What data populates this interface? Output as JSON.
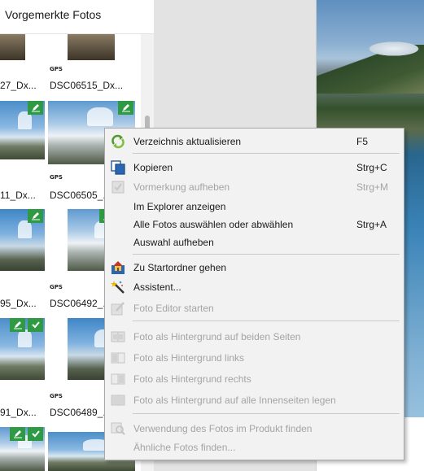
{
  "panel": {
    "title": "Vorgemerkte Fotos",
    "gps_label": "GPS",
    "filenames": {
      "row1_left": "27_Dx...",
      "row1_right": "DSC06515_Dx...",
      "row2_left": "11_Dx...",
      "row2_right": "DSC06505_...",
      "row3_left": "95_Dx...",
      "row3_right": "DSC06492_...",
      "row4_left": "91_Dx...",
      "row4_right": "DSC06489_..."
    }
  },
  "menu": {
    "items": [
      {
        "label": "Verzeichnis aktualisieren",
        "shortcut": "F5",
        "enabled": true,
        "icon": "refresh-icon"
      },
      {
        "label": "Kopieren",
        "shortcut": "Strg+C",
        "enabled": true,
        "icon": "copy-icon"
      },
      {
        "label": "Vormerkung aufheben",
        "shortcut": "Strg+M",
        "enabled": false,
        "icon": "unmark-icon"
      },
      {
        "label": "Im Explorer anzeigen",
        "shortcut": "",
        "enabled": true,
        "icon": ""
      },
      {
        "label": "Alle Fotos auswählen oder abwählen",
        "shortcut": "Strg+A",
        "enabled": true,
        "icon": ""
      },
      {
        "label": "Auswahl aufheben",
        "shortcut": "",
        "enabled": true,
        "icon": ""
      },
      {
        "label": "Zu Startordner gehen",
        "shortcut": "",
        "enabled": true,
        "icon": "home-folder-icon"
      },
      {
        "label": "Assistent...",
        "shortcut": "",
        "enabled": true,
        "icon": "magic-wand-icon"
      },
      {
        "label": "Foto Editor starten",
        "shortcut": "",
        "enabled": false,
        "icon": "photo-editor-icon"
      },
      {
        "label": "Foto als Hintergrund auf beiden Seiten",
        "shortcut": "",
        "enabled": false,
        "icon": "background-both-icon"
      },
      {
        "label": "Foto als Hintergrund links",
        "shortcut": "",
        "enabled": false,
        "icon": "background-left-icon"
      },
      {
        "label": "Foto als Hintergrund rechts",
        "shortcut": "",
        "enabled": false,
        "icon": "background-right-icon"
      },
      {
        "label": "Foto als Hintergrund auf alle Innenseiten legen",
        "shortcut": "",
        "enabled": false,
        "icon": "background-all-icon"
      },
      {
        "label": "Verwendung des Fotos im Produkt finden",
        "shortcut": "",
        "enabled": false,
        "icon": "find-usage-icon"
      },
      {
        "label": "Ähnliche Fotos finden...",
        "shortcut": "",
        "enabled": false,
        "icon": ""
      }
    ]
  },
  "colors": {
    "flag_green": "#2e9a43",
    "menu_bg": "#f2f2f2",
    "disabled_text": "#a4a4a4"
  }
}
